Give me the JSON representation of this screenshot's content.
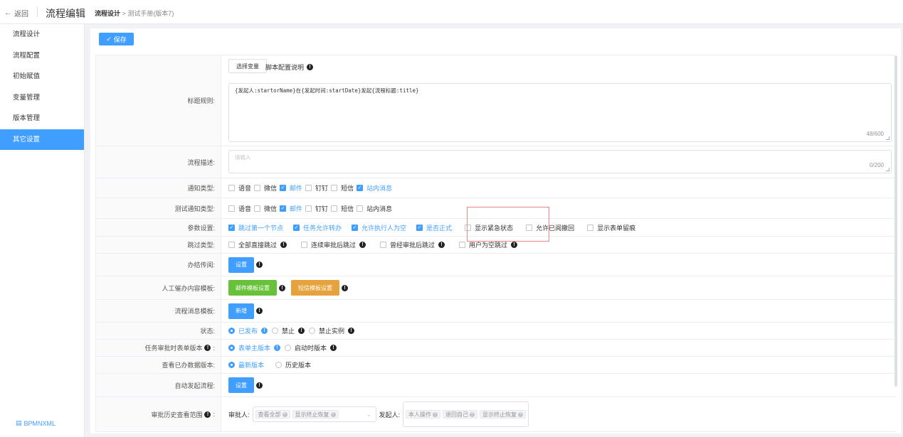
{
  "header": {
    "back_label": "返回",
    "app_title": "流程编辑",
    "breadcrumb_current": "流程设计",
    "breadcrumb_sep": ">",
    "breadcrumb_doc": "测试手册(版本7)"
  },
  "sidebar": {
    "items": [
      {
        "label": "流程设计"
      },
      {
        "label": "流程配置"
      },
      {
        "label": "初始赋值"
      },
      {
        "label": "变量管理"
      },
      {
        "label": "版本管理"
      },
      {
        "label": "其它设置"
      }
    ],
    "active_index": 5,
    "bpmn_label": "BPMNXML"
  },
  "toolbar": {
    "save_label": "保存"
  },
  "form": {
    "title_rule": {
      "label": "标题规则:",
      "select_var": "选择变量",
      "script_desc": "脚本配置说明",
      "value": "{发起人:startorName}在{发起时间:startDate}发起{流程标题:title}",
      "counter": "48/600"
    },
    "desc": {
      "label": "流程描述:",
      "placeholder": "请输入",
      "counter": "0/200"
    },
    "notify": {
      "label": "通知类型:",
      "options": [
        {
          "text": "语音",
          "checked": false
        },
        {
          "text": "微信",
          "checked": false
        },
        {
          "text": "邮件",
          "checked": true
        },
        {
          "text": "钉钉",
          "checked": false
        },
        {
          "text": "短信",
          "checked": false
        },
        {
          "text": "站内消息",
          "checked": true
        }
      ]
    },
    "test_notify": {
      "label": "测试通知类型:",
      "options": [
        {
          "text": "语音",
          "checked": false
        },
        {
          "text": "微信",
          "checked": false
        },
        {
          "text": "邮件",
          "checked": true
        },
        {
          "text": "钉钉",
          "checked": false
        },
        {
          "text": "短信",
          "checked": false
        },
        {
          "text": "站内消息",
          "checked": false
        }
      ]
    },
    "params": {
      "label": "参数设置:",
      "options": [
        {
          "text": "跳过第一个节点",
          "checked": true
        },
        {
          "text": "任务允许转办",
          "checked": true
        },
        {
          "text": "允许执行人为空",
          "checked": true
        },
        {
          "text": "是否正式",
          "checked": true
        },
        {
          "text": "显示紧急状态",
          "checked": false
        },
        {
          "text": "允许已阅撤回",
          "checked": false
        },
        {
          "text": "显示表单留痕",
          "checked": false
        }
      ]
    },
    "skip": {
      "label": "跳过类型:",
      "options": [
        {
          "text": "全部直接跳过"
        },
        {
          "text": "连续审批后跳过"
        },
        {
          "text": "曾经审批后跳过"
        },
        {
          "text": "用户为空跳过"
        }
      ]
    },
    "circulate": {
      "label": "办结传阅:",
      "button": "设置"
    },
    "urge": {
      "label": "人工催办内容模板:",
      "mail_button": "邮件模板设置",
      "sms_button": "短信模板设置"
    },
    "msg_tpl": {
      "label": "流程消息模板:",
      "button": "新增"
    },
    "status": {
      "label": "状态:",
      "options": [
        {
          "text": "已发布",
          "checked": true
        },
        {
          "text": "禁止",
          "checked": false
        },
        {
          "text": "禁止实例",
          "checked": false
        }
      ]
    },
    "task_form": {
      "label": "任务审批时表单版本",
      "options": [
        {
          "text": "表单主版本",
          "checked": true
        },
        {
          "text": "启动时版本",
          "checked": false
        }
      ]
    },
    "view_done": {
      "label": "查看已办数据版本:",
      "options": [
        {
          "text": "最新版本",
          "checked": true
        },
        {
          "text": "历史版本",
          "checked": false
        }
      ]
    },
    "auto_start": {
      "label": "自动发起流程:",
      "button": "设置"
    },
    "history": {
      "label": "审批历史查看范围",
      "approver_label": "审批人:",
      "approver_tags": [
        "查看全部",
        "显示终止恢复"
      ],
      "starter_label": "发起人:",
      "starter_tags": [
        "本人操作",
        "退回自己",
        "显示终止恢复"
      ]
    }
  }
}
